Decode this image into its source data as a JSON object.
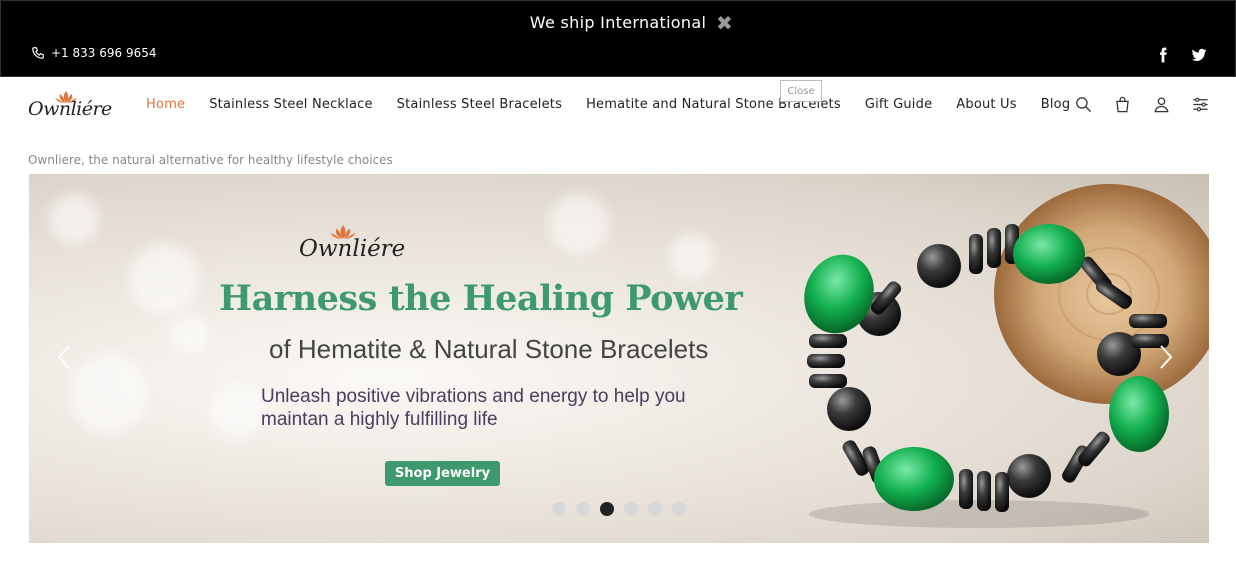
{
  "announcement": {
    "text": "We ship International",
    "close_glyph": "✖"
  },
  "contact": {
    "phone": "+1 833 696 9654",
    "phone_icon": "phone-icon"
  },
  "social": [
    {
      "name": "facebook-icon"
    },
    {
      "name": "twitter-icon"
    }
  ],
  "brand": {
    "logo_text": "Ownliére",
    "accent": "#e0733a",
    "green": "#3e9a6e"
  },
  "nav": {
    "items": [
      {
        "label": "Home",
        "active": true
      },
      {
        "label": "Stainless Steel Necklace"
      },
      {
        "label": "Stainless Steel Bracelets"
      },
      {
        "label": "Hematite and Natural Stone Bracelets"
      },
      {
        "label": "Gift Guide"
      },
      {
        "label": "About Us"
      },
      {
        "label": "Blog"
      }
    ]
  },
  "tooltip": {
    "close": "Close"
  },
  "header_icons": [
    "search-icon",
    "bag-icon",
    "user-icon",
    "settings-sliders-icon"
  ],
  "tagline": "Ownliere, the natural alternative for healthy lifestyle choices",
  "hero": {
    "logo_text": "Ownliére",
    "title": "Harness the Healing Power",
    "subtitle": "of Hematite & Natural Stone Bracelets",
    "description": "Unleash positive vibrations and energy to help you maintan a highly fulfilling life",
    "cta": "Shop Jewelry",
    "slide_count": 6,
    "active_slide": 3
  }
}
